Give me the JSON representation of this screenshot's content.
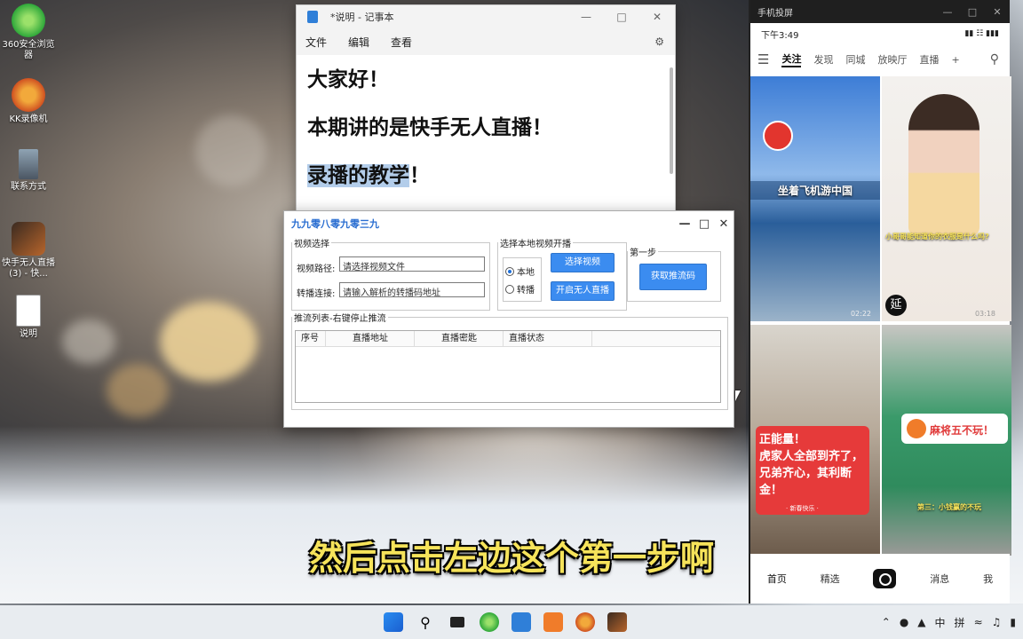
{
  "desktop": {
    "icons": [
      {
        "label": "360安全浏览\n器",
        "icon": "browser-360-icon"
      },
      {
        "label": "KK录像机",
        "icon": "kk-recorder-icon"
      },
      {
        "label": "联系方式",
        "icon": "contact-portrait-icon"
      },
      {
        "label": "快手无人直播\n(3) - 快...",
        "icon": "app-shortcut-icon"
      },
      {
        "label": "说明",
        "icon": "text-file-icon"
      }
    ]
  },
  "notepad": {
    "title": "*说明 - 记事本",
    "menu": [
      "文件",
      "编辑",
      "查看"
    ],
    "lines": [
      "大家好！",
      "本期讲的是快手无人直播！",
      "录播的教学"
    ],
    "line3_suffix": "！"
  },
  "tool": {
    "title": "九九零八零九零三九",
    "video_group": "视频选择",
    "video_path_label": "视频路径:",
    "video_path_value": "请选择视频文件",
    "relay_label": "转播连接:",
    "relay_value": "请输入解析的转播码地址",
    "source_group": "选择本地视频开播",
    "radio_local": "本地",
    "radio_relay": "转播",
    "select_video_btn": "选择视频",
    "start_live_btn": "开启无人直播",
    "step_group": "第一步",
    "get_stream_btn": "获取推流码",
    "list_group": "推流列表-右键停止推流",
    "columns": [
      "序号",
      "直播地址",
      "直播密匙",
      "直播状态"
    ]
  },
  "phone": {
    "window_title": "手机投屏",
    "time": "下午3:49",
    "tabs": [
      "关注",
      "发现",
      "同城",
      "放映厅",
      "直播",
      "+"
    ],
    "tiles": [
      {
        "caption": "坐着飞机游中国",
        "time": "02:22"
      },
      {
        "caption": "小哥哥能知道你的衣服是什么吗?",
        "badge": "延",
        "time": "03:18"
      },
      {
        "caption": "正能量！\n虎家人全部到齐了，兄弟齐心，其利断金！",
        "tag": "· 新春快乐 ·"
      },
      {
        "caption": "麻将五不玩！",
        "sub": "第三：小钱赢的不玩"
      }
    ],
    "bottom_tabs": [
      "首页",
      "精选",
      "消息",
      "我"
    ]
  },
  "subtitle": "然后点击左边这个第一步啊",
  "taskbar": {
    "tray_text": [
      "中",
      "拼"
    ]
  }
}
